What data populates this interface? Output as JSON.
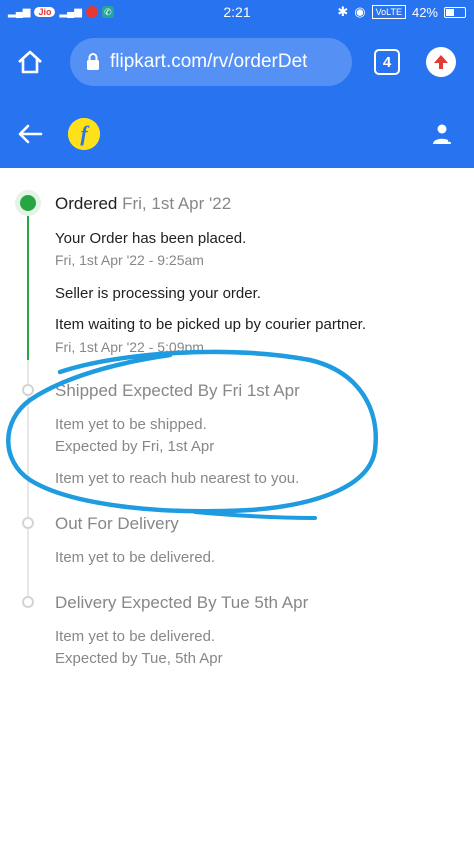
{
  "status_bar": {
    "carrier": "Jio",
    "time": "2:21",
    "network": "VoLTE",
    "battery": "42%"
  },
  "browser": {
    "url": "flipkart.com/rv/orderDet",
    "tab_count": "4",
    "icons": [
      "home-icon",
      "lock-icon",
      "tab-switcher-icon",
      "upload-icon"
    ]
  },
  "app_header": {
    "logo_letter": "f",
    "icons": [
      "back-arrow-icon",
      "flipkart-logo-icon",
      "account-icon"
    ]
  },
  "tracker": {
    "ordered": {
      "title": "Ordered",
      "date": "Fri, 1st Apr '22",
      "events": [
        {
          "text": "Your Order has been placed.",
          "time": "Fri, 1st Apr '22 - 9:25am"
        },
        {
          "text": "Seller is processing your order.",
          "time": ""
        },
        {
          "text": "Item waiting to be picked up by courier partner.",
          "time": "Fri, 1st Apr '22 - 5:09pm"
        }
      ]
    },
    "shipped": {
      "title": "Shipped Expected By Fri 1st Apr",
      "events": [
        "Item yet to be shipped.",
        "Expected by Fri, 1st Apr",
        "Item yet to reach hub nearest to you."
      ]
    },
    "out_for_delivery": {
      "title": "Out For Delivery",
      "events": [
        "Item yet to be delivered."
      ]
    },
    "delivery": {
      "title": "Delivery Expected By Tue 5th Apr",
      "events": [
        "Item yet to be delivered.",
        "Expected by Tue, 5th Apr"
      ]
    }
  },
  "colors": {
    "brand_blue": "#2874f0",
    "progress_green": "#26a541",
    "annotation_blue": "#1f9be0"
  }
}
